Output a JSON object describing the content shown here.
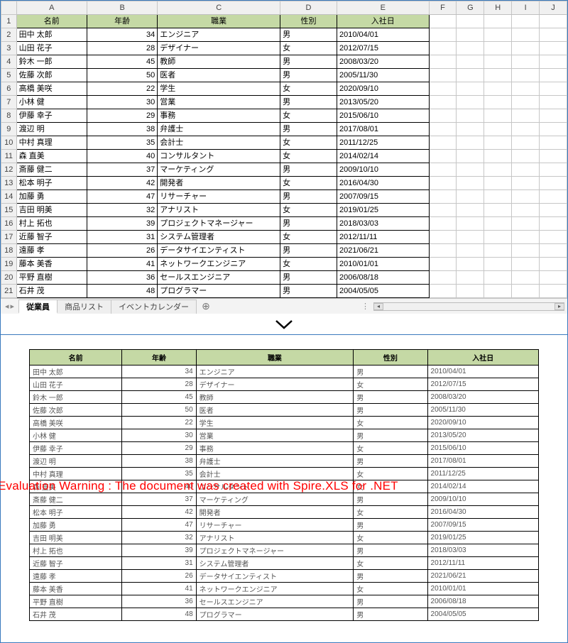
{
  "columns": [
    "A",
    "B",
    "C",
    "D",
    "E",
    "F",
    "G",
    "H",
    "I",
    "J"
  ],
  "headers": [
    "名前",
    "年齢",
    "職業",
    "性別",
    "入社日"
  ],
  "rows": [
    {
      "name": "田中 太郎",
      "age": 34,
      "job": "エンジニア",
      "gender": "男",
      "date": "2010/04/01"
    },
    {
      "name": "山田 花子",
      "age": 28,
      "job": "デザイナー",
      "gender": "女",
      "date": "2012/07/15"
    },
    {
      "name": "鈴木 一郎",
      "age": 45,
      "job": "教師",
      "gender": "男",
      "date": "2008/03/20"
    },
    {
      "name": "佐藤 次郎",
      "age": 50,
      "job": "医者",
      "gender": "男",
      "date": "2005/11/30"
    },
    {
      "name": "高橋 美咲",
      "age": 22,
      "job": "学生",
      "gender": "女",
      "date": "2020/09/10"
    },
    {
      "name": "小林 健",
      "age": 30,
      "job": "営業",
      "gender": "男",
      "date": "2013/05/20"
    },
    {
      "name": "伊藤 幸子",
      "age": 29,
      "job": "事務",
      "gender": "女",
      "date": "2015/06/10"
    },
    {
      "name": "渡辺 明",
      "age": 38,
      "job": "弁護士",
      "gender": "男",
      "date": "2017/08/01"
    },
    {
      "name": "中村 真理",
      "age": 35,
      "job": "会計士",
      "gender": "女",
      "date": "2011/12/25"
    },
    {
      "name": "森 直美",
      "age": 40,
      "job": "コンサルタント",
      "gender": "女",
      "date": "2014/02/14"
    },
    {
      "name": "斎藤 健二",
      "age": 37,
      "job": "マーケティング",
      "gender": "男",
      "date": "2009/10/10"
    },
    {
      "name": "松本 明子",
      "age": 42,
      "job": "開発者",
      "gender": "女",
      "date": "2016/04/30"
    },
    {
      "name": "加藤 勇",
      "age": 47,
      "job": "リサーチャー",
      "gender": "男",
      "date": "2007/09/15"
    },
    {
      "name": "吉田 明美",
      "age": 32,
      "job": "アナリスト",
      "gender": "女",
      "date": "2019/01/25"
    },
    {
      "name": "村上 拓也",
      "age": 39,
      "job": "プロジェクトマネージャー",
      "gender": "男",
      "date": "2018/03/03"
    },
    {
      "name": "近藤 智子",
      "age": 31,
      "job": "システム管理者",
      "gender": "女",
      "date": "2012/11/11"
    },
    {
      "name": "遠藤 孝",
      "age": 26,
      "job": "データサイエンティスト",
      "gender": "男",
      "date": "2021/06/21"
    },
    {
      "name": "藤本 美香",
      "age": 41,
      "job": "ネットワークエンジニア",
      "gender": "女",
      "date": "2010/01/01"
    },
    {
      "name": "平野 直樹",
      "age": 36,
      "job": "セールスエンジニア",
      "gender": "男",
      "date": "2006/08/18"
    },
    {
      "name": "石井 茂",
      "age": 48,
      "job": "プログラマー",
      "gender": "男",
      "date": "2004/05/05"
    }
  ],
  "sheets": {
    "active": "従業員",
    "others": [
      "商品リスト",
      "イベントカレンダー"
    ]
  },
  "tab_add": "⊕",
  "watermark": "Evaluation Warning : The document was created with Spire.XLS for .NET"
}
